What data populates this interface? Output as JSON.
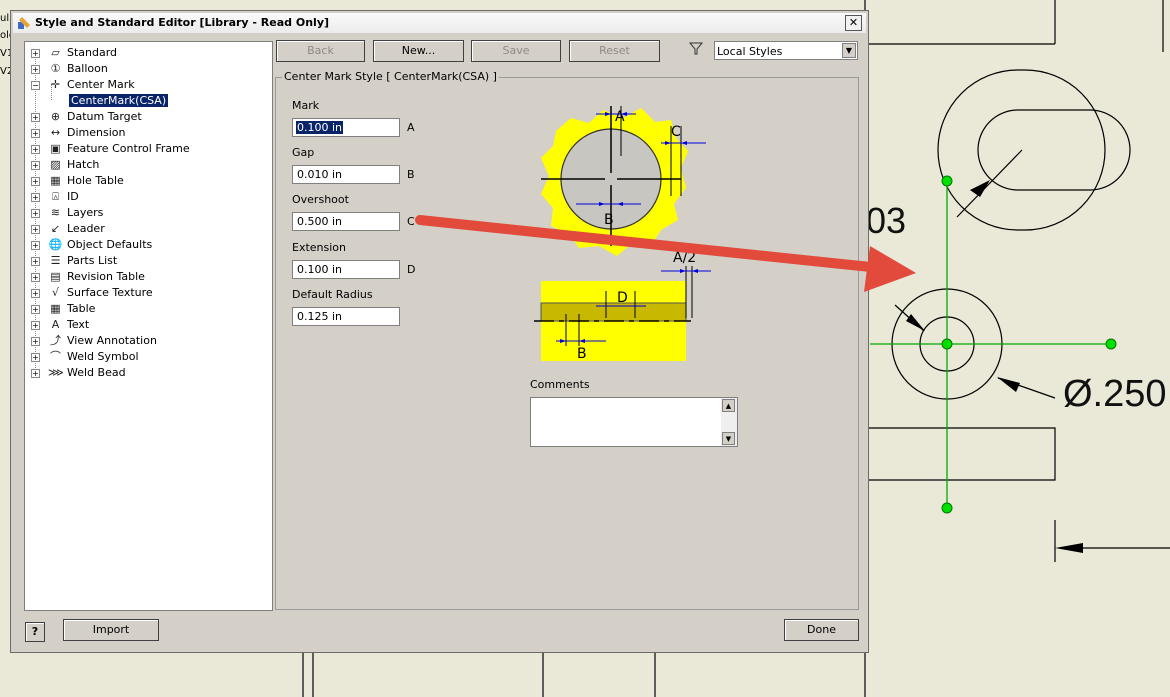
{
  "window": {
    "title": "Style and Standard Editor [Library - Read Only]",
    "close": "✕"
  },
  "toolbar": {
    "back": "Back",
    "new": "New...",
    "save": "Save",
    "reset": "Reset",
    "filter_value": "Local Styles"
  },
  "tree": {
    "items": [
      {
        "label": "Standard",
        "icon": "standard-icon"
      },
      {
        "label": "Balloon",
        "icon": "balloon-icon"
      },
      {
        "label": "Center Mark",
        "icon": "center-mark-icon"
      },
      {
        "label": "CenterMark(CSA)",
        "icon": "",
        "selected": true
      },
      {
        "label": "Datum Target",
        "icon": "datum-target-icon"
      },
      {
        "label": "Dimension",
        "icon": "dimension-icon"
      },
      {
        "label": "Feature Control Frame",
        "icon": "feature-control-frame-icon"
      },
      {
        "label": "Hatch",
        "icon": "hatch-icon"
      },
      {
        "label": "Hole Table",
        "icon": "hole-table-icon"
      },
      {
        "label": "ID",
        "icon": "id-icon"
      },
      {
        "label": "Layers",
        "icon": "layers-icon"
      },
      {
        "label": "Leader",
        "icon": "leader-icon"
      },
      {
        "label": "Object Defaults",
        "icon": "object-defaults-icon"
      },
      {
        "label": "Parts List",
        "icon": "parts-list-icon"
      },
      {
        "label": "Revision Table",
        "icon": "revision-table-icon"
      },
      {
        "label": "Surface Texture",
        "icon": "surface-texture-icon"
      },
      {
        "label": "Table",
        "icon": "table-icon"
      },
      {
        "label": "Text",
        "icon": "text-icon"
      },
      {
        "label": "View Annotation",
        "icon": "view-annotation-icon"
      },
      {
        "label": "Weld Symbol",
        "icon": "weld-symbol-icon"
      },
      {
        "label": "Weld Bead",
        "icon": "weld-bead-icon"
      }
    ]
  },
  "style": {
    "group_title": "Center Mark Style [ CenterMark(CSA) ]",
    "fields": [
      {
        "label": "Mark",
        "value": "0.100 in",
        "letter": "A"
      },
      {
        "label": "Gap",
        "value": "0.010 in",
        "letter": "B"
      },
      {
        "label": "Overshoot",
        "value": "0.500 in",
        "letter": "C"
      },
      {
        "label": "Extension",
        "value": "0.100 in",
        "letter": "D"
      },
      {
        "label": "Default Radius",
        "value": "0.125 in",
        "letter": ""
      }
    ],
    "diagram_labels": {
      "a": "A",
      "b": "B",
      "c": "C",
      "d": "D",
      "a_half": "A/2",
      "b2": "B"
    },
    "comments_label": "Comments",
    "comments_value": ""
  },
  "footer": {
    "help": "?",
    "import": "Import",
    "done": "Done"
  },
  "drawing": {
    "dim_top": "03",
    "dim_diameter": "Ø.250",
    "side_labels": [
      "ul",
      "olo",
      "V1",
      "V2"
    ]
  },
  "colors": {
    "arrow": "#e24a3b",
    "highlight": "#ffff00",
    "selection": "#0a246a",
    "sketch_green": "#00cc00"
  }
}
